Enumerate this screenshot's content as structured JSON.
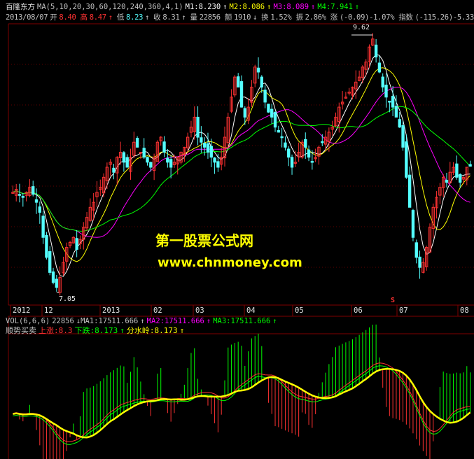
{
  "header": {
    "stock_name": "百隆东方",
    "ma_label": "MA(5,10,20,30,60,120,240,360,4,1)",
    "m1": "M1:8.230",
    "m2": "M2:8.086",
    "m3": "M3:8.089",
    "m4": "M4:7.941",
    "date": "2013/08/07",
    "open_label": "开",
    "open": "8.40",
    "high_label": "高",
    "high": "8.47",
    "low_label": "低",
    "low": "8.23",
    "close_label": "收",
    "close": "8.31",
    "vol_label": "量",
    "vol": "22856",
    "amt_label": "额",
    "amt": "1910",
    "turn_label": "换",
    "turn": "1.52%",
    "amp_label": "振",
    "amp": "2.86%",
    "chg_label": "涨",
    "chg": "(-0.09)-1.07%",
    "idx_label": "指数",
    "idx": "(-115.26)-5.33%"
  },
  "annotations": {
    "high_marker": "9.62",
    "low_marker": "7.05",
    "s_marker": "S"
  },
  "time_axis": [
    "2012",
    "12",
    "2013",
    "02",
    "03",
    "04",
    "05",
    "06",
    "07",
    "08"
  ],
  "vol_header": {
    "label": "VOL(6,6,6)",
    "value": "22856",
    "ma1": "MA1:17511.666",
    "ma2": "MA2:17511.666",
    "ma3": "MA3:17511.666"
  },
  "indicator_header": {
    "name": "顺势买卖",
    "up": "上涨:8.3",
    "down": "下跌:8.173",
    "divide": "分水岭:8.173"
  },
  "watermark": {
    "line1": "第一股票公式网",
    "line2": "www.chnmoney.com"
  },
  "colors": {
    "up_candle": "#ff3232",
    "down_candle": "#54ffff",
    "ma5": "#ffffff",
    "ma10": "#ffff00",
    "ma20": "#ff00ff",
    "ma30": "#00ff00",
    "green_bar": "#00ff00",
    "red_bar": "#ff3232",
    "divide_line": "#ffff00",
    "grid": "#800000"
  },
  "chart_data": {
    "type": "candlestick",
    "y_range": [
      7.05,
      9.62
    ],
    "closes": [
      8.05,
      8.08,
      8.02,
      8.0,
      8.05,
      8.1,
      8.03,
      7.95,
      7.85,
      7.6,
      7.4,
      7.25,
      7.15,
      7.1,
      7.2,
      7.35,
      7.5,
      7.55,
      7.6,
      7.48,
      7.58,
      7.7,
      7.8,
      7.9,
      7.95,
      8.05,
      8.1,
      8.2,
      8.3,
      8.35,
      8.25,
      8.4,
      8.45,
      8.35,
      8.3,
      8.4,
      8.55,
      8.5,
      8.45,
      8.4,
      8.35,
      8.3,
      8.4,
      8.55,
      8.6,
      8.45,
      8.35,
      8.3,
      8.35,
      8.4,
      8.45,
      8.5,
      8.6,
      8.7,
      8.8,
      8.6,
      8.55,
      8.5,
      8.45,
      8.4,
      8.35,
      8.3,
      8.4,
      8.6,
      8.8,
      9.0,
      9.2,
      9.1,
      8.9,
      8.8,
      8.9,
      9.1,
      9.3,
      9.25,
      9.1,
      8.95,
      8.85,
      8.8,
      8.7,
      8.65,
      8.6,
      8.5,
      8.4,
      8.3,
      8.35,
      8.45,
      8.55,
      8.5,
      8.4,
      8.35,
      8.4,
      8.5,
      8.55,
      8.6,
      8.65,
      8.7,
      8.8,
      8.9,
      8.95,
      9.0,
      9.05,
      9.1,
      9.15,
      9.2,
      9.3,
      9.35,
      9.5,
      9.58,
      9.4,
      9.25,
      9.1,
      9.0,
      8.95,
      8.9,
      8.8,
      8.7,
      8.5,
      8.2,
      7.9,
      7.6,
      7.4,
      7.3,
      7.35,
      7.5,
      7.7,
      7.9,
      8.0,
      8.1,
      8.2,
      8.15,
      8.25,
      8.3,
      8.2,
      8.15,
      8.2,
      8.3,
      8.31
    ]
  }
}
